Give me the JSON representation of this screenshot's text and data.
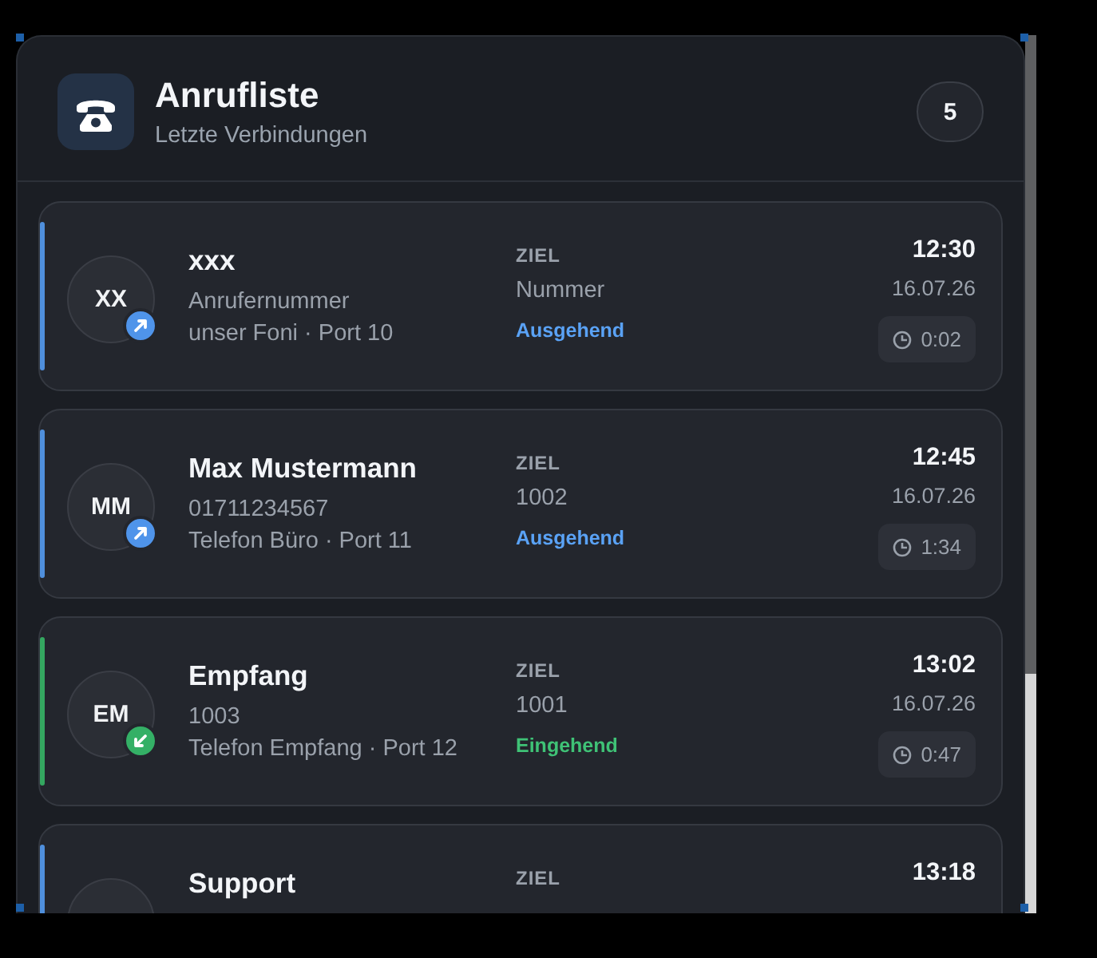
{
  "header": {
    "title": "Anrufliste",
    "subtitle": "Letzte Verbindungen",
    "count": "5"
  },
  "calls": [
    {
      "kind": "outgoing",
      "initials": "XX",
      "name": "xxx",
      "number": "Anrufernummer",
      "device": "unser Foni · Port 10",
      "target_label": "ZIEL",
      "target": "Nummer",
      "direction": "Ausgehend",
      "time": "12:30",
      "date": "16.07.26",
      "duration": "0:02"
    },
    {
      "kind": "outgoing",
      "initials": "MM",
      "name": "Max Mustermann",
      "number": "01711234567",
      "device": "Telefon Büro · Port 11",
      "target_label": "ZIEL",
      "target": "1002",
      "direction": "Ausgehend",
      "time": "12:45",
      "date": "16.07.26",
      "duration": "1:34"
    },
    {
      "kind": "incoming",
      "initials": "EM",
      "name": "Empfang",
      "number": "1003",
      "device": "Telefon Empfang · Port 12",
      "target_label": "ZIEL",
      "target": "1001",
      "direction": "Eingehend",
      "time": "13:02",
      "date": "16.07.26",
      "duration": "0:47"
    },
    {
      "kind": "outgoing",
      "name": "Support",
      "target_label": "ZIEL",
      "time": "13:18"
    }
  ]
}
